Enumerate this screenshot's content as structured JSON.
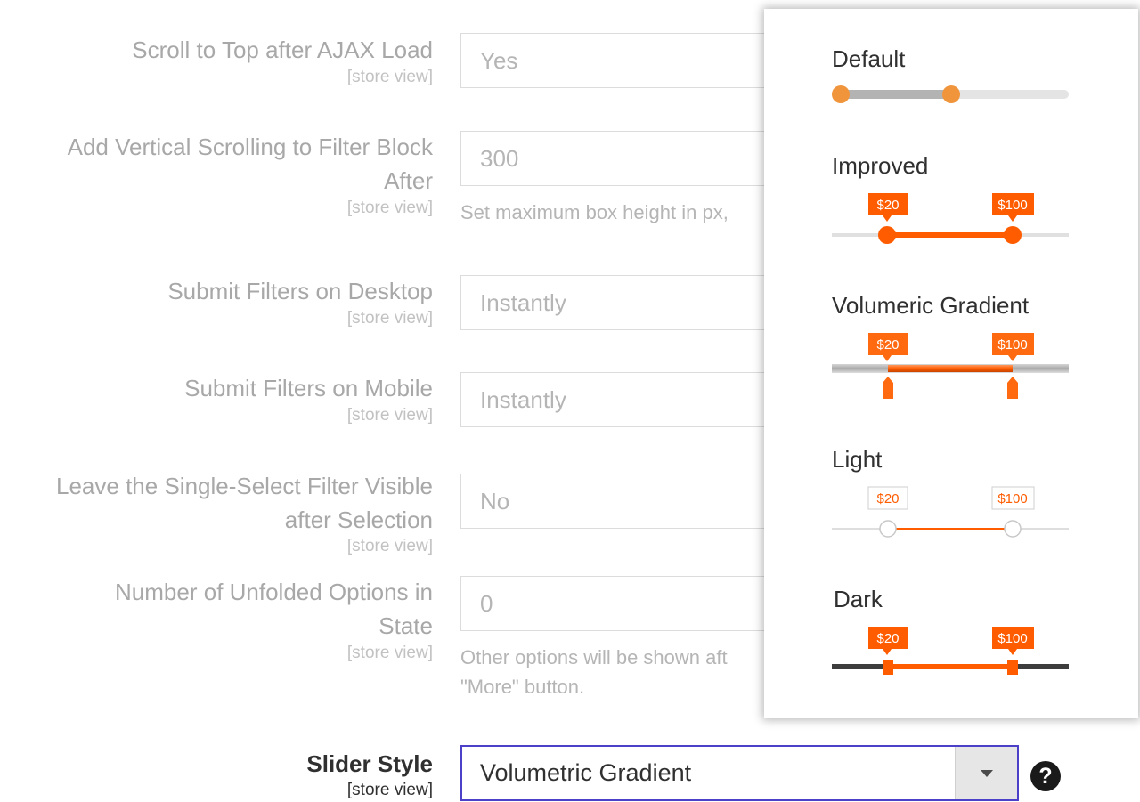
{
  "settings": [
    {
      "label": "Scroll to Top after AJAX Load",
      "scope": "[store view]",
      "value": "Yes"
    },
    {
      "label_lines": [
        "Add Vertical Scrolling to Filter Block",
        "After"
      ],
      "scope": "[store view]",
      "value": "300",
      "note": "Set maximum box height in px,"
    },
    {
      "label": "Submit Filters on Desktop",
      "scope": "[store view]",
      "value": "Instantly"
    },
    {
      "label": "Submit Filters on Mobile",
      "scope": "[store view]",
      "value": "Instantly"
    },
    {
      "label_lines": [
        "Leave the Single-Select Filter Visible",
        "after Selection"
      ],
      "scope": "[store view]",
      "value": "No"
    },
    {
      "label_lines": [
        "Number of Unfolded Options in",
        "State"
      ],
      "scope": "[store view]",
      "value": "0",
      "note_lines": [
        "Other options will be shown aft",
        "\"More\" button."
      ]
    }
  ],
  "slider_style": {
    "label": "Slider Style",
    "scope": "[store view]",
    "value": "Volumetric Gradient",
    "help": "?"
  },
  "preview": {
    "accent": "#ff5c00",
    "default_color": "#f0953c",
    "styles": [
      {
        "name": "Default"
      },
      {
        "name": "Improved",
        "min_label": "$20",
        "max_label": "$100"
      },
      {
        "name": "Volumeric Gradient",
        "min_label": "$20",
        "max_label": "$100"
      },
      {
        "name": "Light",
        "min_label": "$20",
        "max_label": "$100"
      },
      {
        "name": "Dark",
        "min_label": "$20",
        "max_label": "$100"
      }
    ]
  }
}
